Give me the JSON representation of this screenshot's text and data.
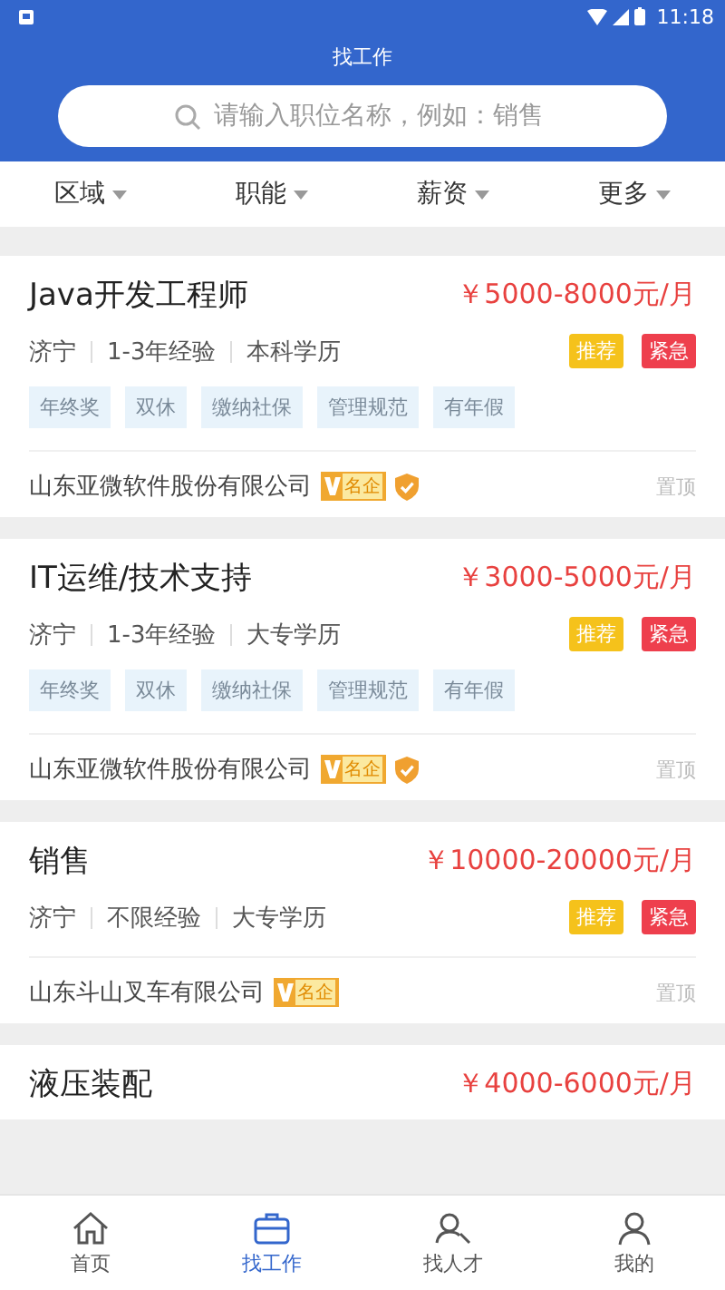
{
  "status_bar": {
    "time": "11:18"
  },
  "header": {
    "title": "找工作"
  },
  "search": {
    "placeholder": "请输入职位名称，例如：销售"
  },
  "filters": [
    "区域",
    "职能",
    "薪资",
    "更多"
  ],
  "jobs": [
    {
      "title": "Java开发工程师",
      "salary": "￥5000-8000元/月",
      "meta": [
        "济宁",
        "1-3年经验",
        "本科学历"
      ],
      "badges": [
        {
          "label": "推荐",
          "kind": "recommend"
        },
        {
          "label": "紧急",
          "kind": "urgent"
        }
      ],
      "benefits": [
        "年终奖",
        "双休",
        "缴纳社保",
        "管理规范",
        "有年假"
      ],
      "company": "山东亚微软件股份有限公司",
      "company_badge": "名企",
      "verified": true,
      "pin": "置顶"
    },
    {
      "title": "IT运维/技术支持",
      "salary": "￥3000-5000元/月",
      "meta": [
        "济宁",
        "1-3年经验",
        "大专学历"
      ],
      "badges": [
        {
          "label": "推荐",
          "kind": "recommend"
        },
        {
          "label": "紧急",
          "kind": "urgent"
        }
      ],
      "benefits": [
        "年终奖",
        "双休",
        "缴纳社保",
        "管理规范",
        "有年假"
      ],
      "company": "山东亚微软件股份有限公司",
      "company_badge": "名企",
      "verified": true,
      "pin": "置顶"
    },
    {
      "title": "销售",
      "salary": "￥10000-20000元/月",
      "meta": [
        "济宁",
        "不限经验",
        "大专学历"
      ],
      "badges": [
        {
          "label": "推荐",
          "kind": "recommend"
        },
        {
          "label": "紧急",
          "kind": "urgent"
        }
      ],
      "company": "山东斗山叉车有限公司",
      "company_badge": "名企",
      "verified": false,
      "pin": "置顶"
    },
    {
      "title": "液压装配",
      "salary": "￥4000-6000元/月"
    }
  ],
  "nav": [
    {
      "label": "首页",
      "kind": "home",
      "selected": false
    },
    {
      "label": "找工作",
      "kind": "jobs",
      "selected": true
    },
    {
      "label": "找人才",
      "kind": "talent",
      "selected": false
    },
    {
      "label": "我的",
      "kind": "profile",
      "selected": false
    }
  ]
}
